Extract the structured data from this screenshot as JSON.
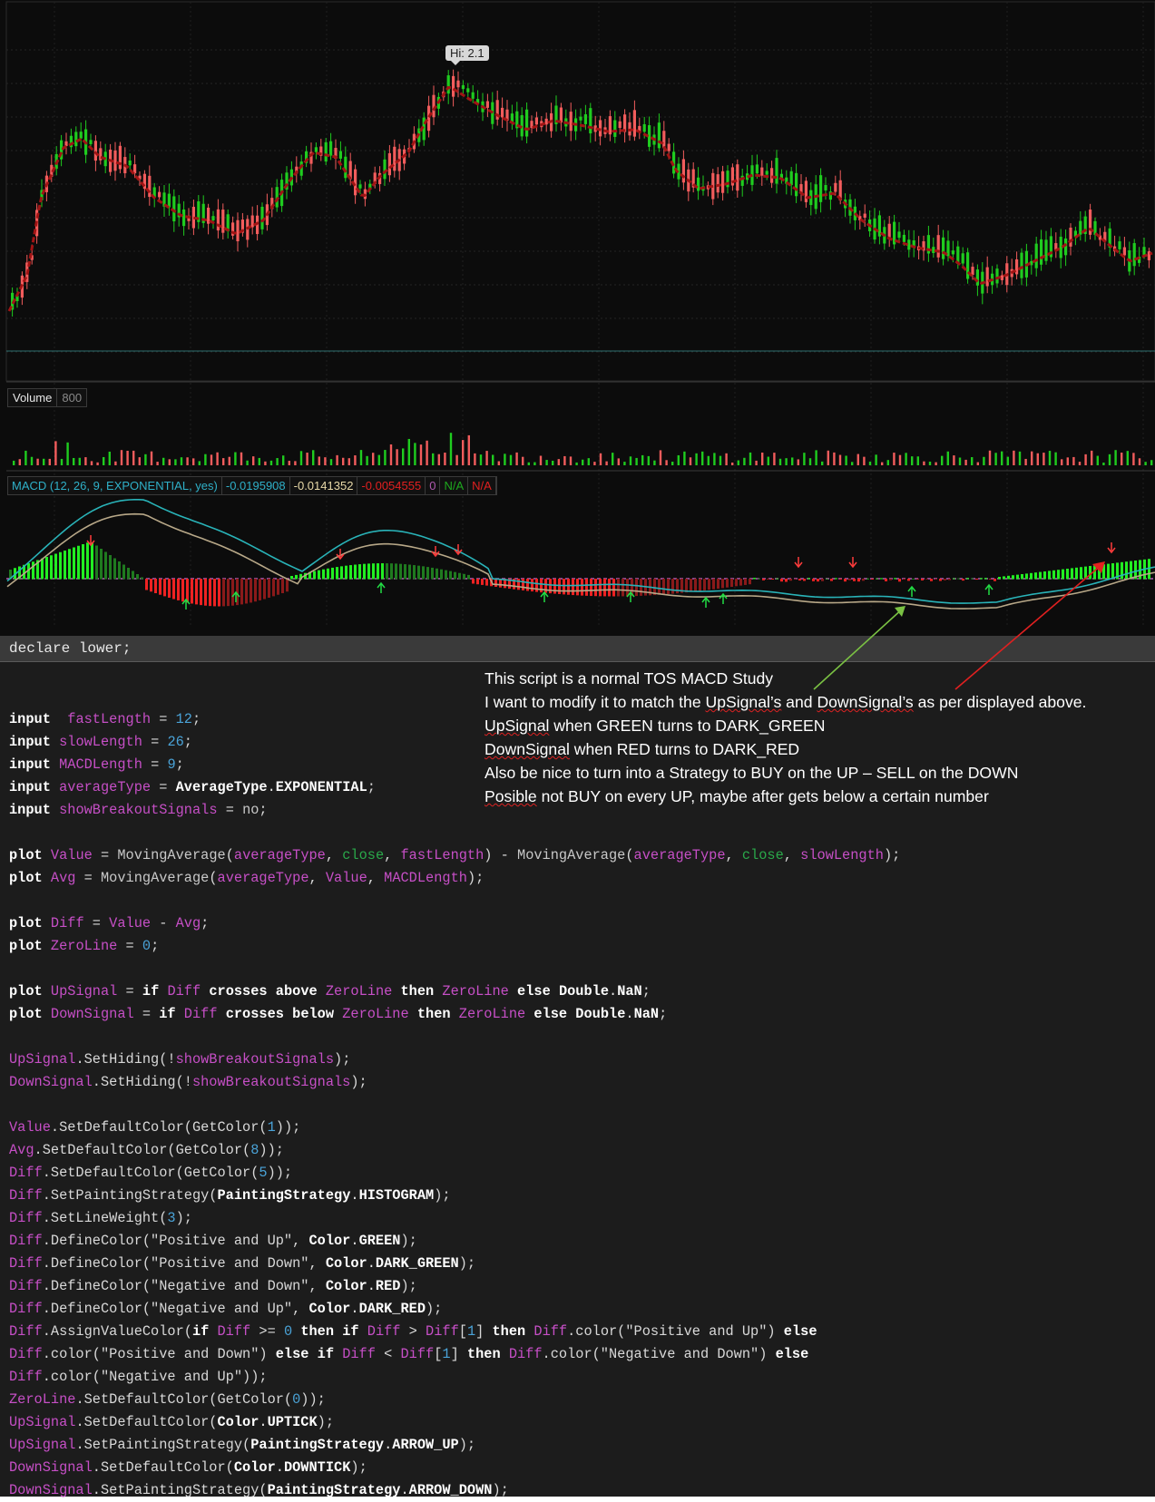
{
  "chart": {
    "hi_label": "Hi: 2.1",
    "volume": {
      "title": "Volume",
      "max": "800"
    },
    "macd_header": [
      {
        "text": "MACD (12, 26, 9, EXPONENTIAL, yes)",
        "color": "#2fb0c8"
      },
      {
        "text": "-0.0195908",
        "color": "#2fb0c8"
      },
      {
        "text": "-0.0141352",
        "color": "#e8d9a8"
      },
      {
        "text": "-0.0054555",
        "color": "#e02020"
      },
      {
        "text": "0",
        "color": "#b05ab0"
      },
      {
        "text": "N/A",
        "color": "#1ea81e"
      },
      {
        "text": "N/A",
        "color": "#e02020"
      }
    ],
    "colors": {
      "up": "#1fcc1f",
      "down": "#f25c5c",
      "ma": "#a11414",
      "value": "#29b3b8",
      "avg": "#b8a888",
      "zero": "#b05ab0"
    }
  },
  "code_header": "declare lower;",
  "code_lines": [
    [],
    [
      [
        "kw",
        "input"
      ],
      [
        "",
        "  "
      ],
      [
        "pp",
        "fastLength"
      ],
      [
        "",
        " = "
      ],
      [
        "nm",
        "12"
      ],
      [
        "",
        ";"
      ]
    ],
    [
      [
        "kw",
        "input"
      ],
      [
        "",
        " "
      ],
      [
        "pp",
        "slowLength"
      ],
      [
        "",
        " = "
      ],
      [
        "nm",
        "26"
      ],
      [
        "",
        ";"
      ]
    ],
    [
      [
        "kw",
        "input"
      ],
      [
        "",
        " "
      ],
      [
        "pp",
        "MACDLength"
      ],
      [
        "",
        " = "
      ],
      [
        "nm",
        "9"
      ],
      [
        "",
        ";"
      ]
    ],
    [
      [
        "kw",
        "input"
      ],
      [
        "",
        " "
      ],
      [
        "pp",
        "averageType"
      ],
      [
        "",
        " = "
      ],
      [
        "cc",
        "AverageType"
      ],
      [
        "st",
        "."
      ],
      [
        "cc",
        "EXPONENTIAL"
      ],
      [
        "",
        ";"
      ]
    ],
    [
      [
        "kw",
        "input"
      ],
      [
        "",
        " "
      ],
      [
        "pp",
        "showBreakoutSignals"
      ],
      [
        "",
        " = "
      ],
      [
        "fn",
        "no"
      ],
      [
        "",
        ";"
      ]
    ],
    [],
    [
      [
        "kw",
        "plot"
      ],
      [
        "",
        " "
      ],
      [
        "pp",
        "Value"
      ],
      [
        "",
        " = "
      ],
      [
        "fn",
        "MovingAverage"
      ],
      [
        "",
        "("
      ],
      [
        "pp",
        "averageType"
      ],
      [
        "",
        ", "
      ],
      [
        "gn",
        "close"
      ],
      [
        "",
        ", "
      ],
      [
        "pp",
        "fastLength"
      ],
      [
        "",
        ") - "
      ],
      [
        "fn",
        "MovingAverage"
      ],
      [
        "",
        "("
      ],
      [
        "pp",
        "averageType"
      ],
      [
        "",
        ", "
      ],
      [
        "gn",
        "close"
      ],
      [
        "",
        ", "
      ],
      [
        "pp",
        "slowLength"
      ],
      [
        "",
        ");"
      ]
    ],
    [
      [
        "kw",
        "plot"
      ],
      [
        "",
        " "
      ],
      [
        "pp",
        "Avg"
      ],
      [
        "",
        " = "
      ],
      [
        "fn",
        "MovingAverage"
      ],
      [
        "",
        "("
      ],
      [
        "pp",
        "averageType"
      ],
      [
        "",
        ", "
      ],
      [
        "pp",
        "Value"
      ],
      [
        "",
        ", "
      ],
      [
        "pp",
        "MACDLength"
      ],
      [
        "",
        ");"
      ]
    ],
    [],
    [
      [
        "kw",
        "plot"
      ],
      [
        "",
        " "
      ],
      [
        "pp",
        "Diff"
      ],
      [
        "",
        " = "
      ],
      [
        "pp",
        "Value"
      ],
      [
        "",
        " - "
      ],
      [
        "pp",
        "Avg"
      ],
      [
        "",
        ";"
      ]
    ],
    [
      [
        "kw",
        "plot"
      ],
      [
        "",
        " "
      ],
      [
        "pp",
        "ZeroLine"
      ],
      [
        "",
        " = "
      ],
      [
        "nm",
        "0"
      ],
      [
        "",
        ";"
      ]
    ],
    [],
    [
      [
        "kw",
        "plot"
      ],
      [
        "",
        " "
      ],
      [
        "pp",
        "UpSignal"
      ],
      [
        "",
        " = "
      ],
      [
        "kw",
        "if"
      ],
      [
        "",
        " "
      ],
      [
        "pp",
        "Diff"
      ],
      [
        "",
        " "
      ],
      [
        "kw",
        "crosses above"
      ],
      [
        "",
        " "
      ],
      [
        "pp",
        "ZeroLine"
      ],
      [
        "",
        " "
      ],
      [
        "kw",
        "then"
      ],
      [
        "",
        " "
      ],
      [
        "pp",
        "ZeroLine"
      ],
      [
        "",
        " "
      ],
      [
        "kw",
        "else"
      ],
      [
        "",
        " "
      ],
      [
        "cc",
        "Double"
      ],
      [
        "st",
        "."
      ],
      [
        "cc",
        "NaN"
      ],
      [
        "",
        ";"
      ]
    ],
    [
      [
        "kw",
        "plot"
      ],
      [
        "",
        " "
      ],
      [
        "pp",
        "DownSignal"
      ],
      [
        "",
        " = "
      ],
      [
        "kw",
        "if"
      ],
      [
        "",
        " "
      ],
      [
        "pp",
        "Diff"
      ],
      [
        "",
        " "
      ],
      [
        "kw",
        "crosses below"
      ],
      [
        "",
        " "
      ],
      [
        "pp",
        "ZeroLine"
      ],
      [
        "",
        " "
      ],
      [
        "kw",
        "then"
      ],
      [
        "",
        " "
      ],
      [
        "pp",
        "ZeroLine"
      ],
      [
        "",
        " "
      ],
      [
        "kw",
        "else"
      ],
      [
        "",
        " "
      ],
      [
        "cc",
        "Double"
      ],
      [
        "st",
        "."
      ],
      [
        "cc",
        "NaN"
      ],
      [
        "",
        ";"
      ]
    ],
    [],
    [
      [
        "pp",
        "UpSignal"
      ],
      [
        "",
        ".SetHiding(!"
      ],
      [
        "pp",
        "showBreakoutSignals"
      ],
      [
        "",
        ");"
      ]
    ],
    [
      [
        "pp",
        "DownSignal"
      ],
      [
        "",
        ".SetHiding(!"
      ],
      [
        "pp",
        "showBreakoutSignals"
      ],
      [
        "",
        ");"
      ]
    ],
    [],
    [
      [
        "pp",
        "Value"
      ],
      [
        "",
        ".SetDefaultColor(GetColor("
      ],
      [
        "nm",
        "1"
      ],
      [
        "",
        "));"
      ]
    ],
    [
      [
        "pp",
        "Avg"
      ],
      [
        "",
        ".SetDefaultColor(GetColor("
      ],
      [
        "nm",
        "8"
      ],
      [
        "",
        "));"
      ]
    ],
    [
      [
        "pp",
        "Diff"
      ],
      [
        "",
        ".SetDefaultColor(GetColor("
      ],
      [
        "nm",
        "5"
      ],
      [
        "",
        "));"
      ]
    ],
    [
      [
        "pp",
        "Diff"
      ],
      [
        "",
        ".SetPaintingStrategy("
      ],
      [
        "cc",
        "PaintingStrategy"
      ],
      [
        "st",
        "."
      ],
      [
        "cc",
        "HISTOGRAM"
      ],
      [
        "",
        ");"
      ]
    ],
    [
      [
        "pp",
        "Diff"
      ],
      [
        "",
        ".SetLineWeight("
      ],
      [
        "nm",
        "3"
      ],
      [
        "",
        ");"
      ]
    ],
    [
      [
        "pp",
        "Diff"
      ],
      [
        "",
        ".DefineColor(\"Positive and Up\", "
      ],
      [
        "cc",
        "Color"
      ],
      [
        "st",
        "."
      ],
      [
        "cc",
        "GREEN"
      ],
      [
        "",
        ");"
      ]
    ],
    [
      [
        "pp",
        "Diff"
      ],
      [
        "",
        ".DefineColor(\"Positive and Down\", "
      ],
      [
        "cc",
        "Color"
      ],
      [
        "st",
        "."
      ],
      [
        "cc",
        "DARK_GREEN"
      ],
      [
        "",
        ");"
      ]
    ],
    [
      [
        "pp",
        "Diff"
      ],
      [
        "",
        ".DefineColor(\"Negative and Down\", "
      ],
      [
        "cc",
        "Color"
      ],
      [
        "st",
        "."
      ],
      [
        "cc",
        "RED"
      ],
      [
        "",
        ");"
      ]
    ],
    [
      [
        "pp",
        "Diff"
      ],
      [
        "",
        ".DefineColor(\"Negative and Up\", "
      ],
      [
        "cc",
        "Color"
      ],
      [
        "st",
        "."
      ],
      [
        "cc",
        "DARK_RED"
      ],
      [
        "",
        ");"
      ]
    ],
    [
      [
        "pp",
        "Diff"
      ],
      [
        "",
        ".AssignValueColor("
      ],
      [
        "kw",
        "if"
      ],
      [
        "",
        " "
      ],
      [
        "pp",
        "Diff"
      ],
      [
        "",
        " >= "
      ],
      [
        "nm",
        "0"
      ],
      [
        "",
        " "
      ],
      [
        "kw",
        "then if"
      ],
      [
        "",
        " "
      ],
      [
        "pp",
        "Diff"
      ],
      [
        "",
        " > "
      ],
      [
        "pp",
        "Diff"
      ],
      [
        "",
        "["
      ],
      [
        "nm",
        "1"
      ],
      [
        "",
        "] "
      ],
      [
        "kw",
        "then"
      ],
      [
        "",
        " "
      ],
      [
        "pp",
        "Diff"
      ],
      [
        "",
        ".color(\"Positive and Up\") "
      ],
      [
        "kw",
        "else"
      ]
    ],
    [
      [
        "pp",
        "Diff"
      ],
      [
        "",
        ".color(\"Positive and Down\") "
      ],
      [
        "kw",
        "else if"
      ],
      [
        "",
        " "
      ],
      [
        "pp",
        "Diff"
      ],
      [
        "",
        " < "
      ],
      [
        "pp",
        "Diff"
      ],
      [
        "",
        "["
      ],
      [
        "nm",
        "1"
      ],
      [
        "",
        "] "
      ],
      [
        "kw",
        "then"
      ],
      [
        "",
        " "
      ],
      [
        "pp",
        "Diff"
      ],
      [
        "",
        ".color(\"Negative and Down\") "
      ],
      [
        "kw",
        "else"
      ]
    ],
    [
      [
        "pp",
        "Diff"
      ],
      [
        "",
        ".color(\"Negative and Up\"));"
      ]
    ],
    [
      [
        "pp",
        "ZeroLine"
      ],
      [
        "",
        ".SetDefaultColor(GetColor("
      ],
      [
        "nm",
        "0"
      ],
      [
        "",
        "));"
      ]
    ],
    [
      [
        "pp",
        "UpSignal"
      ],
      [
        "",
        ".SetDefaultColor("
      ],
      [
        "cc",
        "Color"
      ],
      [
        "st",
        "."
      ],
      [
        "cc",
        "UPTICK"
      ],
      [
        "",
        ");"
      ]
    ],
    [
      [
        "pp",
        "UpSignal"
      ],
      [
        "",
        ".SetPaintingStrategy("
      ],
      [
        "cc",
        "PaintingStrategy"
      ],
      [
        "st",
        "."
      ],
      [
        "cc",
        "ARROW_UP"
      ],
      [
        "",
        ");"
      ]
    ],
    [
      [
        "pp",
        "DownSignal"
      ],
      [
        "",
        ".SetDefaultColor("
      ],
      [
        "cc",
        "Color"
      ],
      [
        "st",
        "."
      ],
      [
        "cc",
        "DOWNTICK"
      ],
      [
        "",
        ");"
      ]
    ],
    [
      [
        "pp",
        "DownSignal"
      ],
      [
        "",
        ".SetPaintingStrategy("
      ],
      [
        "cc",
        "PaintingStrategy"
      ],
      [
        "st",
        "."
      ],
      [
        "cc",
        "ARROW_DOWN"
      ],
      [
        "",
        ");"
      ]
    ]
  ],
  "note_lines": [
    [
      [
        "",
        "This script is a normal TOS MACD Study"
      ]
    ],
    [
      [
        "",
        "I want to modify it to match the "
      ],
      [
        "sq",
        "UpSignal’s"
      ],
      [
        "",
        " and "
      ],
      [
        "sq",
        "DownSignal’s"
      ],
      [
        "",
        " as per displayed above."
      ]
    ],
    [
      [
        "sq",
        "UpSignal"
      ],
      [
        "",
        " when GREEN turns to DARK_GREEN"
      ]
    ],
    [
      [
        "sq",
        "DownSignal"
      ],
      [
        "",
        " when RED turns to DARK_RED"
      ]
    ],
    [
      [
        "",
        "Also be nice to turn into a Strategy   to BUY on the UP – SELL on the DOWN"
      ]
    ],
    [
      [
        "sq",
        "Posible"
      ],
      [
        "",
        " not BUY on every UP, maybe after gets below a certain number"
      ]
    ]
  ]
}
